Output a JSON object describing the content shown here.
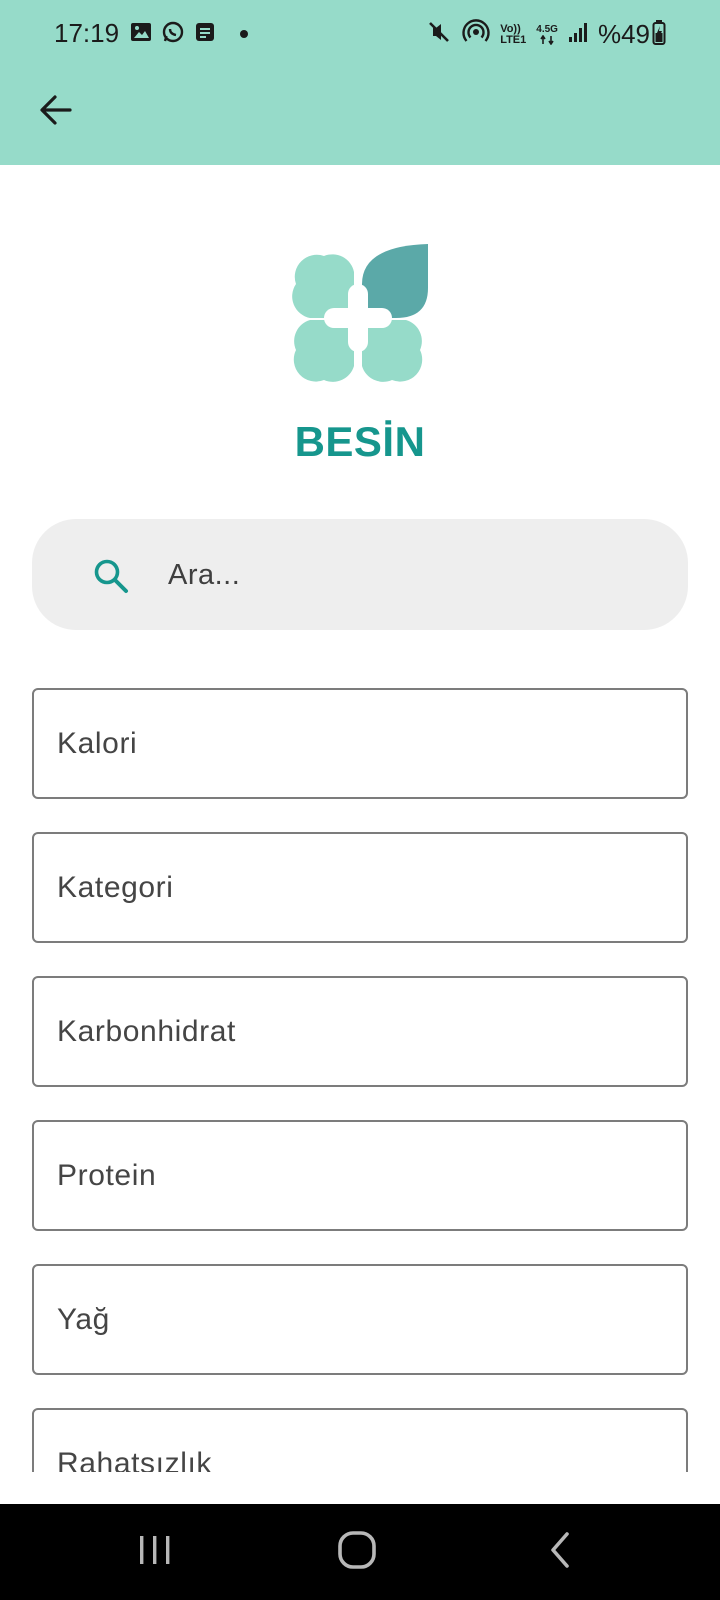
{
  "status_bar": {
    "time": "17:19",
    "left_icons": [
      "gallery-icon",
      "whatsapp-icon",
      "message-icon",
      "notification-dot-icon"
    ],
    "right_icons": [
      "mute-icon",
      "hotspot-icon",
      "volte-icon",
      "network-4-5g-icon",
      "signal-icon",
      "battery-icon"
    ],
    "volte_top": "Vo))",
    "volte_bottom": "LTE1",
    "network_label": "4.5G",
    "battery": "%49"
  },
  "app_bar": {
    "back_icon": "arrow-left-icon"
  },
  "logo": {
    "icon": "clover-plus-logo",
    "colors": {
      "light": "#96dbc9",
      "dark": "#5ba9a8",
      "cross": "#ffffff"
    }
  },
  "brand": {
    "title": "BESİN",
    "color": "#16968d"
  },
  "search": {
    "placeholder": "Ara...",
    "value": "",
    "icon": "search-icon",
    "icon_color": "#16968d"
  },
  "filters": [
    {
      "label": "Kalori"
    },
    {
      "label": "Kategori"
    },
    {
      "label": "Karbonhidrat"
    },
    {
      "label": "Protein"
    },
    {
      "label": "Yağ"
    },
    {
      "label": "Rahatsızlık"
    }
  ],
  "nav_bar": {
    "recents_icon": "recents-icon",
    "home_icon": "home-icon",
    "back_icon": "nav-back-icon"
  }
}
